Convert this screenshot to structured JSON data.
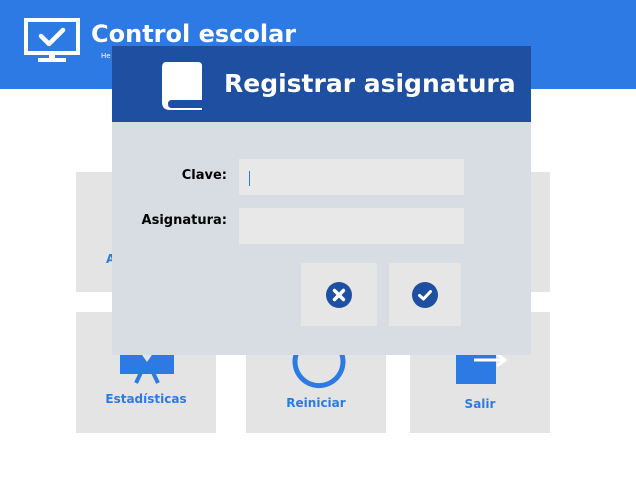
{
  "app": {
    "title": "Control escolar",
    "subtitle": "He"
  },
  "tiles": [
    {
      "label": "Estadísticas",
      "icon": "presentation-board-icon"
    },
    {
      "label": "Reiniciar",
      "icon": "refresh-icon"
    },
    {
      "label": "Salir",
      "icon": "exit-icon"
    }
  ],
  "tiles_peek": {
    "left_text": "A"
  },
  "dialog": {
    "title": "Registrar asignatura",
    "icon": "book-icon",
    "fields": {
      "clave": {
        "label": "Clave:",
        "value": ""
      },
      "asignatura": {
        "label": "Asignatura:",
        "value": ""
      }
    },
    "buttons": {
      "cancel": {
        "icon": "cancel-circle-icon"
      },
      "confirm": {
        "icon": "check-circle-icon"
      }
    }
  },
  "colors": {
    "header_blue": "#2d7ae5",
    "dialog_header_blue": "#1e4fa1",
    "dialog_bg": "#d8dce3",
    "tile_bg": "#e4e4e4"
  }
}
